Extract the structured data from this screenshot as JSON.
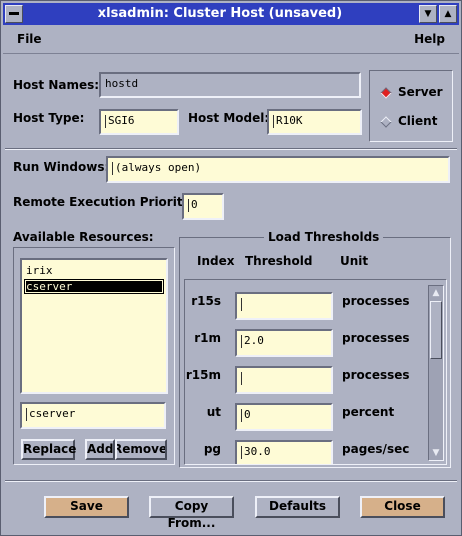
{
  "window": {
    "title": "xlsadmin: Cluster Host (unsaved)",
    "menus": [
      "File",
      "Help"
    ]
  },
  "host": {
    "names_label": "Host Names:",
    "names_value": "hostd",
    "type_label": "Host Type:",
    "type_value": "SGI6",
    "model_label": "Host Model:",
    "model_value": "R10K"
  },
  "role": {
    "options": [
      {
        "label": "Server",
        "selected": true
      },
      {
        "label": "Client",
        "selected": false
      }
    ],
    "selected_color": "#e02020"
  },
  "run": {
    "windows_label": "Run Windows:",
    "windows_value": "(always open)",
    "priority_label": "Remote Execution Priority:",
    "priority_value": "0"
  },
  "resources": {
    "label": "Available Resources:",
    "items": [
      "irix",
      "cserver"
    ],
    "selected": "cserver",
    "entry_value": "cserver",
    "buttons": {
      "replace": "Replace",
      "add": "Add",
      "remove": "Remove"
    }
  },
  "thresholds": {
    "title": "Load Thresholds",
    "headers": {
      "index": "Index",
      "threshold": "Threshold",
      "unit": "Unit"
    },
    "rows": [
      {
        "index": "r15s",
        "value": "",
        "unit": "processes"
      },
      {
        "index": "r1m",
        "value": "2.0",
        "unit": "processes"
      },
      {
        "index": "r15m",
        "value": "",
        "unit": "processes"
      },
      {
        "index": "ut",
        "value": "0",
        "unit": "percent"
      },
      {
        "index": "pg",
        "value": "30.0",
        "unit": "pages/sec"
      }
    ]
  },
  "actions": {
    "save": "Save",
    "copy_from": "Copy From...",
    "defaults": "Defaults",
    "close": "Close"
  }
}
